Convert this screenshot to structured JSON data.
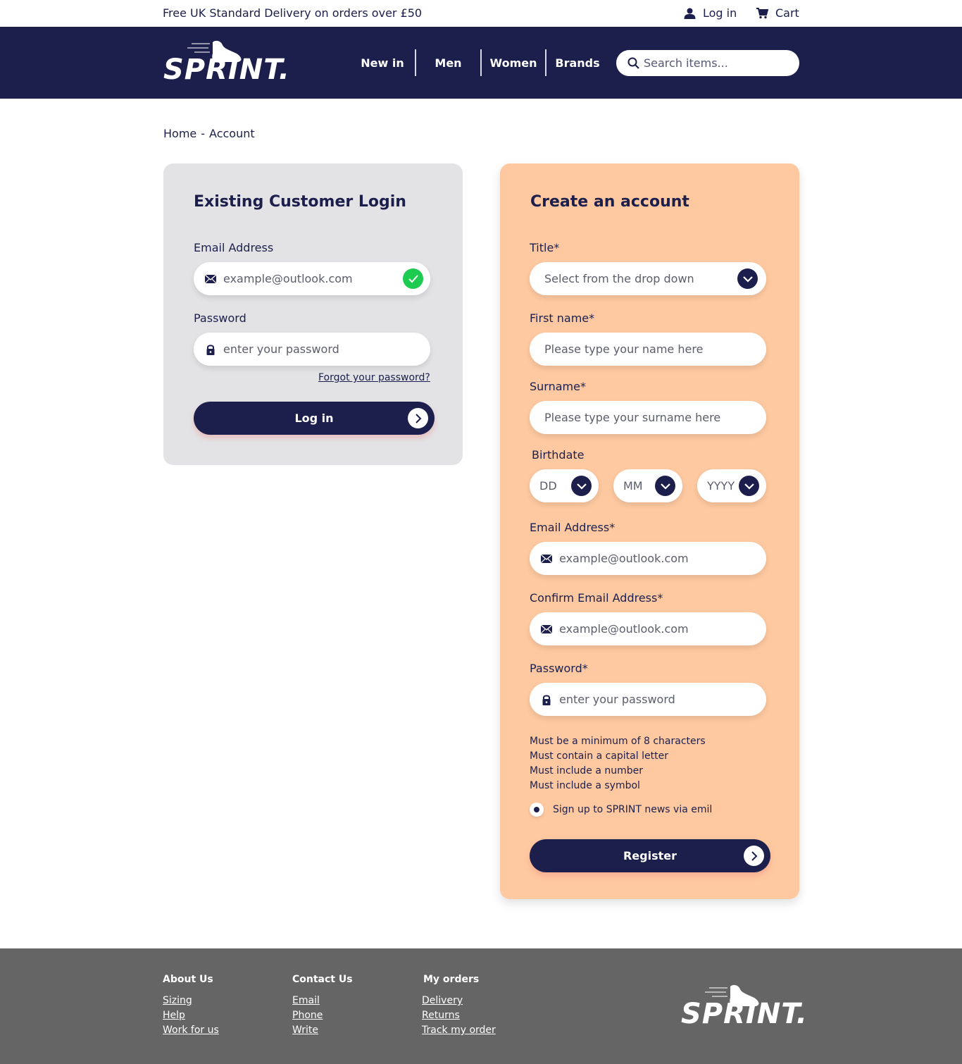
{
  "topbar": {
    "promo": "Free UK Standard Delivery on orders over £50",
    "login_label": "Log in",
    "cart_label": "Cart",
    "icons": {
      "login": "user-icon",
      "cart": "cart-icon"
    }
  },
  "header": {
    "logo_text": "SPRINT.",
    "nav": [
      "New in",
      "Men",
      "Women",
      "Brands"
    ],
    "search_placeholder": "Search items..."
  },
  "breadcrumb": {
    "home": "Home",
    "separator": "-",
    "current": "Account"
  },
  "login": {
    "title": "Existing Customer Login",
    "email_label": "Email Address",
    "email_placeholder": "example@outlook.com",
    "password_label": "Password",
    "password_placeholder": "enter your password",
    "forgot": "Forgot your password?",
    "button": "Log in"
  },
  "create": {
    "title": "Create an account",
    "title_label": "Title*",
    "title_select": "Select from the drop down",
    "first_name_label": "First name*",
    "first_name_placeholder": "Please type your name here",
    "surname_label": "Surname*",
    "surname_placeholder": "Please type your surname here",
    "birthdate_label": "Birthdate",
    "dd": "DD",
    "mm": "MM",
    "yyyy": "YYYY",
    "email_label": "Email Address*",
    "email_placeholder": "example@outlook.com",
    "confirm_email_label": "Confirm Email Address*",
    "confirm_email_placeholder": "example@outlook.com",
    "password_label": "Password*",
    "password_placeholder": "enter your password",
    "rules": [
      "Must be a minimum of 8 characters",
      "Must contain a capital letter",
      "Must include a number",
      "Must include a symbol"
    ],
    "newsletter": "Sign up to SPRINT news via emil",
    "button": "Register"
  },
  "footer": {
    "about": {
      "heading": "About Us",
      "links": [
        "Sizing",
        "Help",
        "Work for us"
      ]
    },
    "contact": {
      "heading": "Contact  Us",
      "links": [
        "Email ",
        "Phone",
        "Write"
      ]
    },
    "orders": {
      "heading": "My orders",
      "links": [
        "Delivery ",
        "Returns",
        "Track my order"
      ]
    },
    "logo_text": "SPRINT."
  },
  "colors": {
    "navy": "#1c1f4c",
    "peach": "#fec9a0",
    "grey_card": "#e3e3e5",
    "footer": "#666565",
    "success": "#1ccb4f"
  }
}
